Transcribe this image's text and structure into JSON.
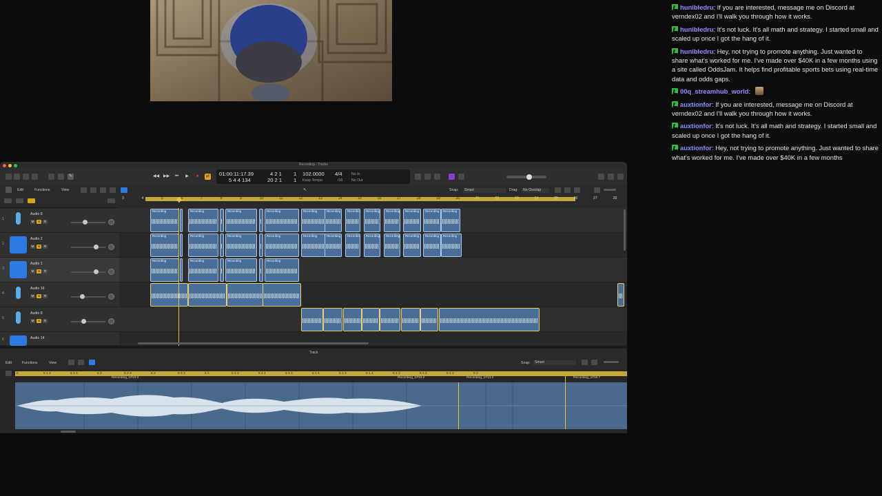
{
  "video": {
    "alt": "stream webcam"
  },
  "chat": {
    "messages": [
      {
        "user": "hunibledru",
        "text": "If you are interested, message me on Discord at verndex02 and I'll walk you through how it works.",
        "has_emote": false
      },
      {
        "user": "hunibledru",
        "text": "It's not luck. It's all math and strategy. I started small and scaled up once I got the hang of it.",
        "has_emote": false
      },
      {
        "user": "hunibledru",
        "text": "Hey, not trying to promote anything. Just wanted to share what's worked for me. I've made over $40K in a few months using a site called OddsJam. It helps find profitable sports bets using real-time data and odds gaps.",
        "has_emote": false
      },
      {
        "user": "00q_streamhub_world",
        "text": "",
        "has_emote": true
      },
      {
        "user": "auxtionfor",
        "text": "If you are interested, message me on Discord at verndex02 and I'll walk you through how it works.",
        "has_emote": false
      },
      {
        "user": "auxtionfor",
        "text": "It's not luck. It's all math and strategy. I started small and scaled up once I got the hang of it.",
        "has_emote": false
      },
      {
        "user": "auxtionfor",
        "text": "Hey, not trying to promote anything. Just wanted to share what's worked for me. I've made over $40K in a few months",
        "has_emote": false
      }
    ]
  },
  "daw": {
    "window_title": "Recording - Tracks",
    "lcd": {
      "smpte": "01:00:11:17.39",
      "smpte2": "5 4 4 134",
      "bars": "4 2 1",
      "bars_sub": "20 2 1",
      "beat": "1",
      "beat2": "1",
      "tempo": "102.0000",
      "tempo_mode": "Keep Tempo",
      "sig": "4/4",
      "div": "/16",
      "in_label": "No In",
      "out_label": "No Out"
    },
    "menu": {
      "edit": "Edit",
      "functions": "Functions",
      "view": "View",
      "snap_label": "Snap:",
      "snap_value": "Smart",
      "drag_label": "Drag:",
      "drag_value": "No Overlap"
    },
    "ruler": [
      "3",
      "4",
      "5",
      "6",
      "7",
      "8",
      "9",
      "10",
      "11",
      "12",
      "13",
      "14",
      "15",
      "16",
      "17",
      "18",
      "19",
      "20",
      "21",
      "22",
      "23",
      "24",
      "25",
      "26",
      "27",
      "28"
    ],
    "tracks": [
      {
        "num": "1",
        "name": "Audio 8",
        "icon": "mic-icon"
      },
      {
        "num": "2",
        "name": "Audio 2",
        "icon": "waveform-icon"
      },
      {
        "num": "3",
        "name": "Audio 1",
        "icon": "waveform-icon"
      },
      {
        "num": "4",
        "name": "Audio 16",
        "icon": "mic-icon"
      },
      {
        "num": "5",
        "name": "Audio 8",
        "icon": "mic-icon"
      },
      {
        "num": "6",
        "name": "Audio 14",
        "icon": "waveform-icon"
      }
    ],
    "mute": "M",
    "solo": "S",
    "rec": "R",
    "region_label": "Recording",
    "editor": {
      "title": "Track",
      "edit": "Edit",
      "functions": "Functions",
      "view": "View",
      "snap_label": "Snap:",
      "snap_value": "Smart",
      "region1": "Recording_1#13.2",
      "region2": "Recording_1#13.2",
      "region3": "Recording_1#13.2",
      "region4": "Recording_1#16.7",
      "ruler": [
        "5",
        "6 1 3",
        "6 1 3",
        "6 2",
        "6 2 3",
        "6 3",
        "6 3 3",
        "6 4",
        "6 4 3",
        "6 4 4",
        "6 4 3",
        "6 1 4",
        "6 1 3",
        "6 1 4",
        "6 1 3",
        "6 1 4",
        "6 1 3",
        "6 2"
      ]
    }
  }
}
